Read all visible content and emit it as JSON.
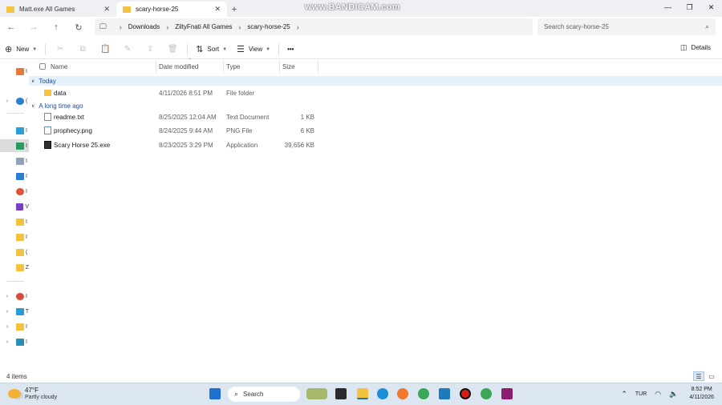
{
  "tabs": [
    {
      "label": "Matt.exe All Games",
      "active": false
    },
    {
      "label": "scary-horse-25",
      "active": true
    }
  ],
  "watermark": "www.BANDICAM.com",
  "breadcrumb": [
    "Downloads",
    "ZiltyFnati All Games",
    "scary-horse-25"
  ],
  "search": {
    "placeholder": "Search scary-horse-25"
  },
  "commands": {
    "new": "New",
    "sort": "Sort",
    "view": "View",
    "more": "•••",
    "details": "Details"
  },
  "columns": {
    "name": "Name",
    "date": "Date modified",
    "type": "Type",
    "size": "Size"
  },
  "groups": [
    {
      "label": "Today",
      "files": [
        {
          "name": "data",
          "date": "4/11/2026 8:51 PM",
          "type": "File folder",
          "size": "",
          "icon": "folder"
        }
      ]
    },
    {
      "label": "A long time ago",
      "files": [
        {
          "name": "readme.txt",
          "date": "8/25/2025 12:04 AM",
          "type": "Text Document",
          "size": "1 KB",
          "icon": "text-file"
        },
        {
          "name": "prophecy.png",
          "date": "8/24/2025 9:44 AM",
          "type": "PNG File",
          "size": "6 KB",
          "icon": "image-file"
        },
        {
          "name": "Scary Horse 25.exe",
          "date": "8/23/2025 3:29 PM",
          "type": "Application",
          "size": "39,656 KB",
          "icon": "application"
        }
      ]
    }
  ],
  "status": {
    "items": "4 items"
  },
  "taskbar": {
    "temperature": "47°F",
    "condition": "Partly cloudy",
    "search": "Search",
    "language": "TUR",
    "time": "8:52 PM",
    "date": "4/11/2026"
  },
  "colors": {
    "accent": "#1f4b99",
    "folder": "#f3c23f",
    "taskbar": "#dce6f1",
    "group_highlight": "#e5f1fb"
  }
}
